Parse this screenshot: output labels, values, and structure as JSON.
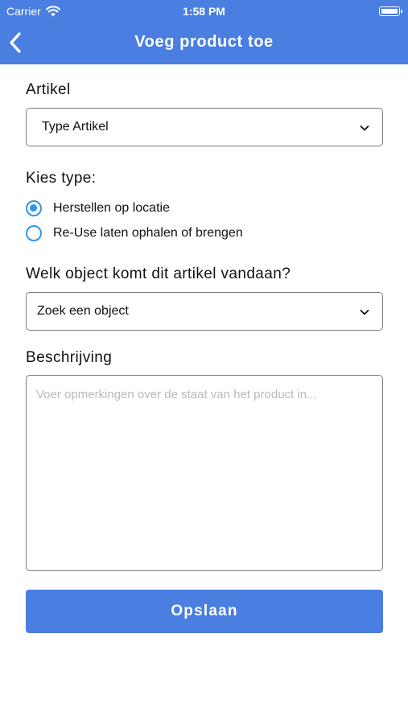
{
  "status_bar": {
    "carrier": "Carrier",
    "time": "1:58 PM"
  },
  "nav": {
    "title": "Voeg product toe",
    "back_icon": "chevron-left-icon"
  },
  "form": {
    "artikel": {
      "label": "Artikel",
      "selected": "Type Artikel"
    },
    "type": {
      "label": "Kies type:",
      "options": [
        {
          "label": "Herstellen op locatie",
          "checked": true
        },
        {
          "label": "Re-Use laten ophalen of brengen",
          "checked": false
        }
      ]
    },
    "object": {
      "label": "Welk object komt dit artikel vandaan?",
      "selected": "Zoek een object"
    },
    "beschrijving": {
      "label": "Beschrijving",
      "placeholder": "Voer opmerkingen over de staat van het product in...",
      "value": ""
    },
    "save_label": "Opslaan"
  },
  "colors": {
    "primary": "#4a7ee0",
    "radio": "#2f95ea",
    "border": "#7a7a7a",
    "placeholder": "#b9b9b9"
  }
}
